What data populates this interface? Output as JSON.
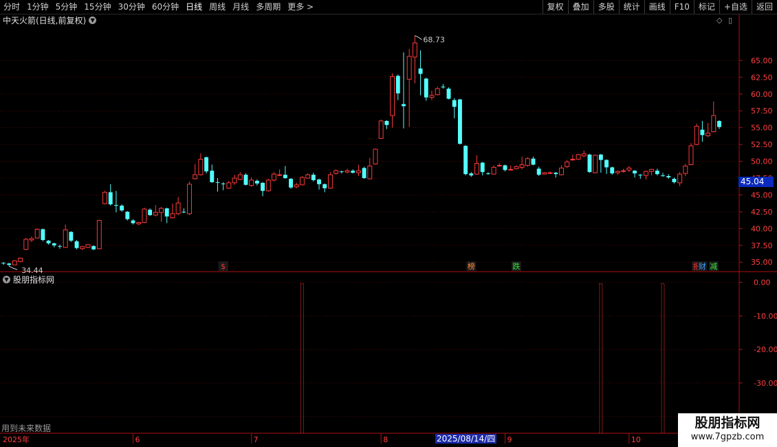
{
  "toolbar": {
    "left": [
      {
        "label": "分时"
      },
      {
        "label": "1分钟"
      },
      {
        "label": "5分钟"
      },
      {
        "label": "15分钟"
      },
      {
        "label": "30分钟"
      },
      {
        "label": "60分钟"
      },
      {
        "label": "日线",
        "active": true
      },
      {
        "label": "周线"
      },
      {
        "label": "月线"
      },
      {
        "label": "多周期"
      },
      {
        "label": "更多 >"
      }
    ],
    "right": [
      {
        "label": "复权"
      },
      {
        "label": "叠加"
      },
      {
        "label": "多股"
      },
      {
        "label": "统计"
      },
      {
        "label": "画线"
      },
      {
        "label": "F10"
      },
      {
        "label": "标记"
      },
      {
        "label": "+自选"
      },
      {
        "label": "返回"
      }
    ]
  },
  "chart": {
    "title": "中天火箭(日线,前复权)",
    "high_label": "68.73",
    "low_label": "34.44",
    "current_price": "45.04",
    "up_color": "#ff3b3b",
    "down_color": "#54ffff",
    "axis_color": "#b01010",
    "markers": [
      {
        "text": "$",
        "color": "#ff3030",
        "date_index": 27
      },
      {
        "text": "榜",
        "color": "#ff8c3a",
        "date_index": 57
      },
      {
        "text": "跌",
        "color": "#39e639",
        "date_index": 62
      },
      {
        "text": "报",
        "color": "#ff3030",
        "date_index": 84
      },
      {
        "text": "财",
        "color": "#3aa0ff",
        "date_index": 85
      },
      {
        "text": "减",
        "color": "#39e639",
        "date_index": 86
      }
    ]
  },
  "indicator": {
    "title": "股朋指标网",
    "future_note": "用到未来数据"
  },
  "date_axis": {
    "year": "2025年",
    "months": [
      "6",
      "7",
      "8",
      "9",
      "10"
    ],
    "highlight": "2025/08/14/四"
  },
  "watermark": {
    "line1": "股朋指标网",
    "line2": "www.7gpzb.com"
  },
  "chart_data": [
    {
      "type": "candlestick",
      "title": "中天火箭(日线,前复权)",
      "y_ticks": [
        35.0,
        37.5,
        40.0,
        42.5,
        45.0,
        47.5,
        50.0,
        52.5,
        55.0,
        57.5,
        60.0,
        62.5,
        65.0
      ],
      "ylim": [
        33.9,
        70.2
      ],
      "x_month_labels": [
        {
          "label": "6",
          "index": 16
        },
        {
          "label": "7",
          "index": 30
        },
        {
          "label": "8",
          "index": 46
        },
        {
          "label": "9",
          "index": 61
        },
        {
          "label": "10",
          "index": 76
        }
      ],
      "candles": [
        [
          34.9,
          34.8,
          35.0,
          34.6
        ],
        [
          34.8,
          34.6,
          34.9,
          34.4
        ],
        [
          34.6,
          35.2,
          35.3,
          34.6
        ],
        [
          35.1,
          35.6,
          35.7,
          35.0
        ],
        [
          36.9,
          38.4,
          38.6,
          36.8
        ],
        [
          38.3,
          38.5,
          38.8,
          38.0
        ],
        [
          38.6,
          39.9,
          40.0,
          38.5
        ],
        [
          39.9,
          38.3,
          40.0,
          38.1
        ],
        [
          38.2,
          37.8,
          38.3,
          37.6
        ],
        [
          37.8,
          37.5,
          37.9,
          37.2
        ],
        [
          37.4,
          37.3,
          37.6,
          37.0
        ],
        [
          37.2,
          39.8,
          40.6,
          37.2
        ],
        [
          39.5,
          38.2,
          39.6,
          38.0
        ],
        [
          38.1,
          37.1,
          38.3,
          36.9
        ],
        [
          37.0,
          37.3,
          37.4,
          36.8
        ],
        [
          37.2,
          37.6,
          37.7,
          37.1
        ],
        [
          37.4,
          36.9,
          37.5,
          36.8
        ],
        [
          37.0,
          41.2,
          41.3,
          36.9
        ],
        [
          43.7,
          45.4,
          45.6,
          43.6
        ],
        [
          45.4,
          43.6,
          46.6,
          43.4
        ],
        [
          43.5,
          43.4,
          45.6,
          42.4
        ],
        [
          43.4,
          42.7,
          43.6,
          42.5
        ],
        [
          42.5,
          41.4,
          42.6,
          41.2
        ],
        [
          41.2,
          40.8,
          41.4,
          40.6
        ],
        [
          40.7,
          40.9,
          41.0,
          40.5
        ],
        [
          40.9,
          42.9,
          43.1,
          40.8
        ],
        [
          42.8,
          42.0,
          43.0,
          41.9
        ],
        [
          42.0,
          42.4,
          43.5,
          41.8
        ],
        [
          42.4,
          43.0,
          43.2,
          41.0
        ],
        [
          43.0,
          41.8,
          43.1,
          40.8
        ],
        [
          41.6,
          42.2,
          43.7,
          41.5
        ],
        [
          42.2,
          43.8,
          44.7,
          42.0
        ],
        [
          42.5,
          42.4,
          43.0,
          42.3
        ],
        [
          42.2,
          46.6,
          47.0,
          42.0
        ],
        [
          47.4,
          48.0,
          49.6,
          47.3
        ],
        [
          48.0,
          50.3,
          51.2,
          47.9
        ],
        [
          50.6,
          48.5,
          50.7,
          48.2
        ],
        [
          48.6,
          46.9,
          49.5,
          46.8
        ],
        [
          46.9,
          46.8,
          47.5,
          45.5
        ],
        [
          46.7,
          46.6,
          46.9,
          45.7
        ],
        [
          46.0,
          46.8,
          47.1,
          45.9
        ],
        [
          46.8,
          47.5,
          48.0,
          46.5
        ],
        [
          47.3,
          48.0,
          48.4,
          47.2
        ],
        [
          48.0,
          46.5,
          48.2,
          46.4
        ],
        [
          46.4,
          47.2,
          47.6,
          46.2
        ],
        [
          47.1,
          46.7,
          47.3,
          46.4
        ],
        [
          46.8,
          45.6,
          46.9,
          44.8
        ],
        [
          45.6,
          47.2,
          47.4,
          45.5
        ],
        [
          47.2,
          48.1,
          48.4,
          47.0
        ],
        [
          48.0,
          48.0,
          48.8,
          47.8
        ],
        [
          48.0,
          47.5,
          49.3,
          47.4
        ],
        [
          47.4,
          46.1,
          47.5,
          45.9
        ],
        [
          46.2,
          46.5,
          46.8,
          46.0
        ],
        [
          46.5,
          47.6,
          47.8,
          46.4
        ],
        [
          47.5,
          48.0,
          48.2,
          47.4
        ],
        [
          48.0,
          47.2,
          48.3,
          47.0
        ],
        [
          47.3,
          46.6,
          47.4,
          45.8
        ],
        [
          46.6,
          46.0,
          46.7,
          45.4
        ],
        [
          46.0,
          48.0,
          48.4,
          45.9
        ],
        [
          48.2,
          48.6,
          48.8,
          48.0
        ],
        [
          48.5,
          48.4,
          48.6,
          48.2
        ],
        [
          48.4,
          48.6,
          48.9,
          48.2
        ],
        [
          48.6,
          48.3,
          48.8,
          48.2
        ],
        [
          48.3,
          48.6,
          49.5,
          47.8
        ],
        [
          49.0,
          47.5,
          49.2,
          47.4
        ],
        [
          47.4,
          49.3,
          50.5,
          47.3
        ],
        [
          49.6,
          51.8,
          51.9,
          49.5
        ],
        [
          53.4,
          56.0,
          56.2,
          53.3
        ],
        [
          56.0,
          55.4,
          56.1,
          54.8
        ],
        [
          56.8,
          62.6,
          63.1,
          55.0
        ],
        [
          62.7,
          60.1,
          62.9,
          59.1
        ],
        [
          58.5,
          58.2,
          66.2,
          54.9
        ],
        [
          62.2,
          65.6,
          66.7,
          55.1
        ],
        [
          65.5,
          67.6,
          68.7,
          61.6
        ],
        [
          63.8,
          63.0,
          66.5,
          59.8
        ],
        [
          62.3,
          59.5,
          62.4,
          59.0
        ],
        [
          59.5,
          59.8,
          60.5,
          59.1
        ],
        [
          59.9,
          60.8,
          61.1,
          59.8
        ],
        [
          61.1,
          61.0,
          61.5,
          60.8
        ],
        [
          60.8,
          59.3,
          61.0,
          59.2
        ],
        [
          59.1,
          58.1,
          59.4,
          56.4
        ],
        [
          59.2,
          52.6,
          59.3,
          52.5
        ],
        [
          52.3,
          48.1,
          52.4,
          47.9
        ],
        [
          48.2,
          47.9,
          48.4,
          47.7
        ],
        [
          48.1,
          49.7,
          50.9,
          48.0
        ],
        [
          49.8,
          48.4,
          49.9,
          47.9
        ],
        [
          48.2,
          48.1,
          48.4,
          48.0
        ],
        [
          48.1,
          49.1,
          49.4,
          48.0
        ],
        [
          49.3,
          49.4,
          49.7,
          49.2
        ],
        [
          49.4,
          48.7,
          49.5,
          48.5
        ],
        [
          48.7,
          48.8,
          49.4,
          48.6
        ],
        [
          48.9,
          49.2,
          49.4,
          48.8
        ],
        [
          49.1,
          49.5,
          50.7,
          48.8
        ],
        [
          49.4,
          50.4,
          50.6,
          49.2
        ],
        [
          50.4,
          49.5,
          50.7,
          49.4
        ],
        [
          48.9,
          48.0,
          49.2,
          47.8
        ],
        [
          48.1,
          48.3,
          48.4,
          48.1
        ],
        [
          48.2,
          48.3,
          48.5,
          48.1
        ],
        [
          48.3,
          48.1,
          48.4,
          47.6
        ],
        [
          48.0,
          49.0,
          49.4,
          47.9
        ],
        [
          49.2,
          49.9,
          50.2,
          49.0
        ],
        [
          50.2,
          50.3,
          51.0,
          50.1
        ],
        [
          50.3,
          51.0,
          51.1,
          50.2
        ],
        [
          50.8,
          51.1,
          51.6,
          50.6
        ],
        [
          51.0,
          48.4,
          51.1,
          48.3
        ],
        [
          48.3,
          50.9,
          51.0,
          48.2
        ],
        [
          51.0,
          50.2,
          51.1,
          48.3
        ],
        [
          50.2,
          49.1,
          50.3,
          48.1
        ],
        [
          49.1,
          48.2,
          49.2,
          48.0
        ],
        [
          48.3,
          48.5,
          48.6,
          48.0
        ],
        [
          48.5,
          48.6,
          48.9,
          48.3
        ],
        [
          48.7,
          49.0,
          49.3,
          48.4
        ],
        [
          48.6,
          48.2,
          48.7,
          47.6
        ],
        [
          48.0,
          47.9,
          48.1,
          47.4
        ],
        [
          47.9,
          48.5,
          48.6,
          47.3
        ],
        [
          48.5,
          48.8,
          48.9,
          47.9
        ],
        [
          48.6,
          48.1,
          48.9,
          47.9
        ],
        [
          47.9,
          47.8,
          48.3,
          47.7
        ],
        [
          47.8,
          47.6,
          48.1,
          47.4
        ],
        [
          47.4,
          46.9,
          47.6,
          46.7
        ],
        [
          46.8,
          48.1,
          48.4,
          46.3
        ],
        [
          48.2,
          49.3,
          49.6,
          47.8
        ],
        [
          49.5,
          52.3,
          52.7,
          49.4
        ],
        [
          52.5,
          55.2,
          55.6,
          52.4
        ],
        [
          54.7,
          53.9,
          56.0,
          52.9
        ],
        [
          53.8,
          54.2,
          55.7,
          53.6
        ],
        [
          54.4,
          56.8,
          58.9,
          54.3
        ],
        [
          56.0,
          55.1,
          56.1,
          54.8
        ]
      ]
    },
    {
      "type": "bar",
      "title": "股朋指标网",
      "y_ticks": [
        0.0,
        -10.0,
        -20.0,
        -30.0,
        -40.0
      ],
      "ylim": [
        -45,
        3
      ],
      "bars": [
        {
          "index": 53,
          "value": -50
        },
        {
          "index": 106,
          "value": -50
        },
        {
          "index": 117,
          "value": -50
        }
      ]
    }
  ]
}
